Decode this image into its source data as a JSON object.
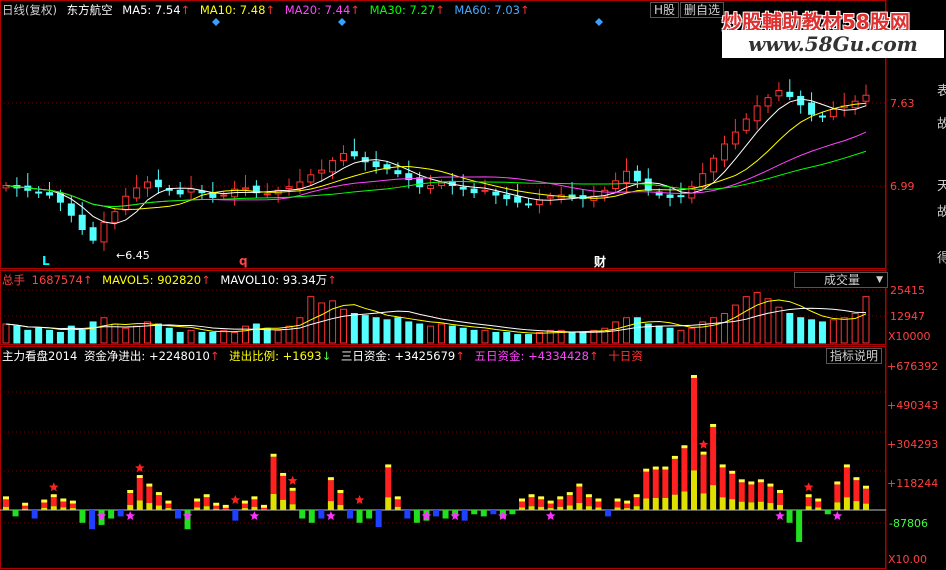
{
  "header": {
    "chart_type": "日线(复权)",
    "stock_name": "东方航空",
    "ma": [
      {
        "label": "MA5: 7.54",
        "color": "#ffffff"
      },
      {
        "label": "MA10: 7.48",
        "color": "#ffff00"
      },
      {
        "label": "MA20: 7.44",
        "color": "#ff44ff"
      },
      {
        "label": "MA30: 7.27",
        "color": "#00ff00"
      },
      {
        "label": "MA60: 7.03",
        "color": "#44aaff"
      }
    ],
    "buttons": [
      "H股",
      "删自选"
    ]
  },
  "watermark": {
    "line1": "炒股輔助教材58股网",
    "line2": "www.58Gu.com"
  },
  "price_panel": {
    "ticks": [
      "7.63",
      "6.99"
    ],
    "low_label": "←6.45",
    "markers": [
      {
        "label": "L",
        "color": "#00ffff"
      },
      {
        "label": "q",
        "color": "#ff4444"
      },
      {
        "label": "财",
        "color": "#ffffff"
      }
    ],
    "right_edge_labels": [
      "表",
      "故",
      "天",
      "故",
      "得"
    ]
  },
  "volume_panel": {
    "title_prefix": "总手",
    "total": "1687574",
    "mavol5": "MAVOL5: 902820",
    "mavol10": "MAVOL10: 93.34万",
    "selector": "成交量",
    "ticks": [
      "25415",
      "12947",
      "X10000"
    ]
  },
  "indicator_panel": {
    "title": "主力看盘2014",
    "items": [
      {
        "label": "资金净进出: +2248010",
        "color": "#ffffff"
      },
      {
        "label": "进出比例: +1693",
        "color": "#ffff00"
      },
      {
        "label": "三日资金: +3425679",
        "color": "#ffffff"
      },
      {
        "label": "五日资金: +4334428",
        "color": "#ff44ff"
      },
      {
        "label": "十日资",
        "color": "#ff3333"
      }
    ],
    "help_button": "指标说明",
    "ticks": [
      "+676392",
      "+490343",
      "+304293",
      "+118244",
      "-87806",
      "X10.00"
    ]
  },
  "colors": {
    "up": "#ff3232",
    "down": "#54ffff",
    "ma5": "#ffffff",
    "ma10": "#ffff00",
    "ma20": "#ff44ff",
    "ma30": "#00ff00",
    "ma60": "#44aaff",
    "frame": "#b00000"
  },
  "chart_data": [
    {
      "type": "candlestick",
      "title": "东方航空 日线(复权)",
      "ylim": [
        6.45,
        8.1
      ],
      "yticks": [
        7.63,
        6.99
      ],
      "close": [
        7.06,
        7.04,
        7.02,
        7.0,
        6.98,
        6.92,
        6.81,
        6.69,
        6.6,
        6.75,
        6.84,
        6.97,
        7.04,
        7.09,
        7.05,
        7.02,
        6.99,
        7.03,
        7.0,
        6.96,
        6.98,
        7.03,
        7.04,
        7.0,
        6.99,
        7.02,
        7.05,
        7.09,
        7.15,
        7.19,
        7.27,
        7.33,
        7.31,
        7.26,
        7.22,
        7.2,
        7.16,
        7.11,
        7.05,
        7.06,
        7.08,
        7.06,
        7.03,
        7.0,
        7.02,
        6.98,
        6.95,
        6.92,
        6.9,
        6.94,
        6.97,
        6.98,
        6.96,
        6.95,
        6.97,
        7.02,
        7.1,
        7.18,
        7.1,
        7.02,
        6.98,
        6.96,
        6.97,
        7.05,
        7.16,
        7.29,
        7.41,
        7.51,
        7.62,
        7.73,
        7.8,
        7.86,
        7.81,
        7.74,
        7.66,
        7.64,
        7.7,
        7.73,
        7.77,
        7.82
      ],
      "low_annotation": 6.45
    },
    {
      "type": "bar",
      "title": "成交量",
      "unit": "X10000",
      "yticks": [
        25415,
        12947
      ],
      "values": [
        9,
        8,
        6,
        7,
        6,
        5,
        8,
        6,
        10,
        12,
        9,
        7,
        8,
        10,
        9,
        7,
        5,
        6,
        5,
        5,
        6,
        5,
        8,
        9,
        7,
        6,
        8,
        12,
        22,
        19,
        20,
        16,
        14,
        13,
        12,
        11,
        12,
        10,
        9,
        8,
        9,
        8,
        7,
        6,
        6,
        5,
        5,
        4,
        4,
        5,
        6,
        6,
        5,
        5,
        6,
        7,
        10,
        12,
        12,
        9,
        8,
        7,
        6,
        7,
        10,
        12,
        14,
        18,
        22,
        24,
        21,
        17,
        14,
        12,
        11,
        10,
        11,
        12,
        14,
        22
      ],
      "series": [
        {
          "name": "MAVOL5"
        },
        {
          "name": "MAVOL10"
        }
      ]
    },
    {
      "type": "bar",
      "title": "主力看盘2014",
      "unit": "X10.00",
      "yticks": [
        676392,
        490343,
        304293,
        118244,
        -87806
      ],
      "ylim": [
        -150000,
        740000
      ],
      "values": [
        50000,
        -30000,
        20000,
        -40000,
        35000,
        60000,
        40000,
        30000,
        -60000,
        -90000,
        -70000,
        -40000,
        -30000,
        80000,
        150000,
        110000,
        70000,
        30000,
        -40000,
        -90000,
        40000,
        60000,
        20000,
        10000,
        -50000,
        30000,
        50000,
        10000,
        250000,
        160000,
        90000,
        -40000,
        -60000,
        -40000,
        140000,
        80000,
        -40000,
        -60000,
        -40000,
        -80000,
        200000,
        50000,
        -40000,
        -60000,
        -50000,
        -30000,
        -40000,
        -30000,
        -50000,
        -20000,
        -30000,
        -20000,
        -40000,
        -20000,
        40000,
        60000,
        50000,
        30000,
        50000,
        70000,
        110000,
        60000,
        40000,
        -30000,
        40000,
        30000,
        60000,
        180000,
        190000,
        190000,
        240000,
        290000,
        620000,
        260000,
        390000,
        200000,
        170000,
        130000,
        120000,
        130000,
        110000,
        80000,
        -60000,
        -150000,
        60000,
        40000,
        -20000,
        120000,
        200000,
        140000,
        100000
      ]
    }
  ]
}
